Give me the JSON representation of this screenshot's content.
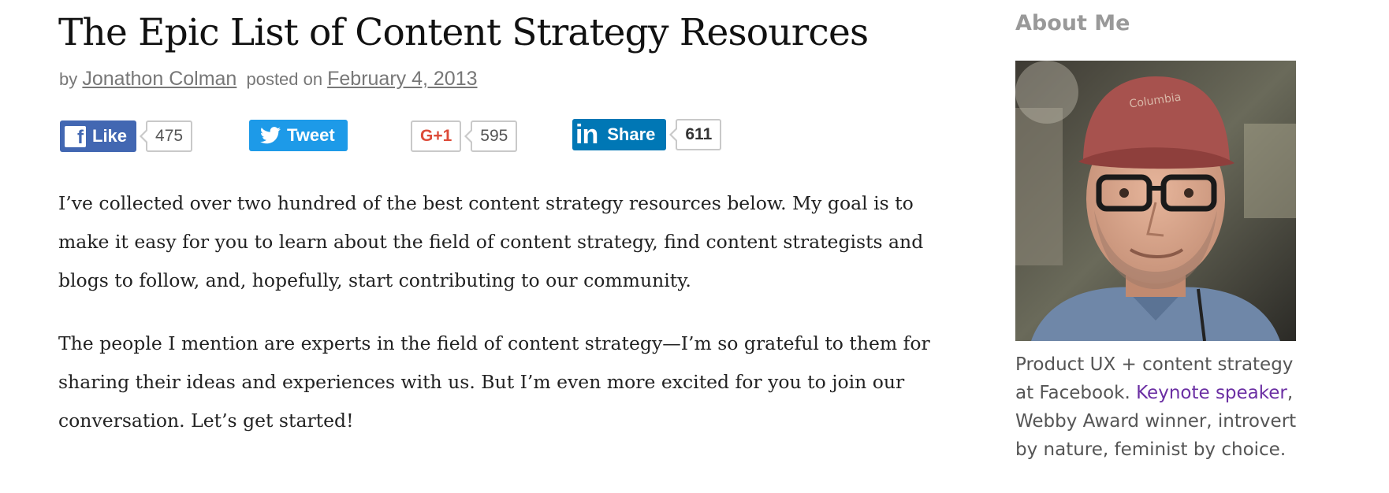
{
  "article": {
    "title": "The Epic List of Content Strategy Resources",
    "byline_prefix": "by",
    "author": "Jonathon Colman",
    "posted_on": "posted on",
    "date": "February 4, 2013",
    "paragraphs": [
      "I’ve collected over two hundred of the best content strategy resources below. My goal is to make it easy for you to learn about the field of content strategy, find content strategists and blogs to follow, and, hopefully, start contributing to our community.",
      "The people I mention are experts in the field of content strategy—I’m so grateful to them for sharing their ideas and experiences with us. But I’m even more excited for you to join our conversation. Let’s get started!"
    ]
  },
  "share": {
    "facebook": {
      "label": "Like",
      "count": "475",
      "icon": "facebook-icon",
      "color": "#4267b2"
    },
    "twitter": {
      "label": "Tweet",
      "icon": "twitter-bird-icon",
      "color": "#1d9ae8"
    },
    "google_plus": {
      "label": "G+1",
      "count": "595",
      "color": "#dd4b39"
    },
    "linkedin": {
      "icon_text": "in",
      "label": "Share",
      "count": "611",
      "color": "#0077b5"
    }
  },
  "sidebar": {
    "title": "About Me",
    "photo_icon": "author-photo",
    "bio_before": "Product UX + content strategy at Facebook. ",
    "bio_link": "Keynote speaker",
    "bio_after": ", Webby Award winner, introvert by nature, feminist by choice.",
    "link_color": "#6b2fa3"
  }
}
